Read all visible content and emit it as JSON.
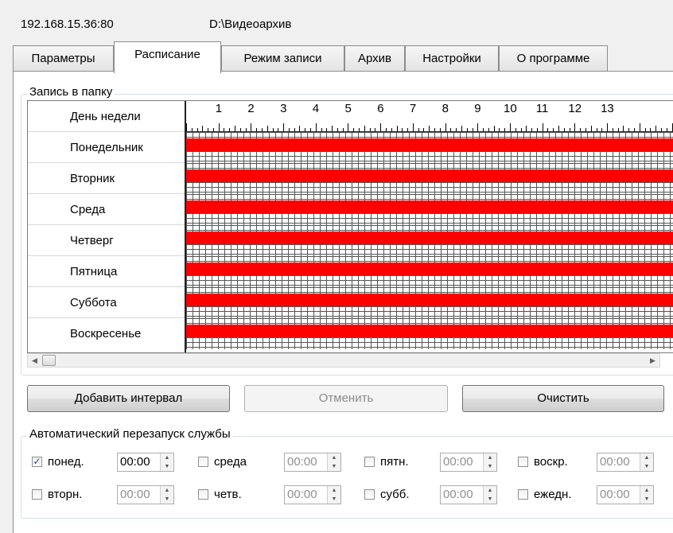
{
  "header": {
    "address": "192.168.15.36:80",
    "path": "D:\\Видеоархив"
  },
  "tabs": [
    {
      "label": "Параметры",
      "active": false
    },
    {
      "label": "Расписание",
      "active": true
    },
    {
      "label": "Режим записи",
      "active": false
    },
    {
      "label": "Архив",
      "active": false
    },
    {
      "label": "Настройки",
      "active": false
    },
    {
      "label": "О программе",
      "active": false
    }
  ],
  "schedule": {
    "group_title": "Запись в папку",
    "header_label": "День недели",
    "hours": [
      "1",
      "2",
      "3",
      "4",
      "5",
      "6",
      "7",
      "8",
      "9",
      "10",
      "11",
      "12",
      "13"
    ],
    "days": [
      "Понедельник",
      "Вторник",
      "Среда",
      "Четверг",
      "Пятница",
      "Суббота",
      "Воскресенье"
    ],
    "recording_color": "#ff0000"
  },
  "buttons": {
    "add_interval": "Добавить интервал",
    "cancel": "Отменить",
    "clear": "Очистить"
  },
  "restart": {
    "group_title": "Автоматический перезапуск службы",
    "items": [
      {
        "label": "понед.",
        "checked": true,
        "time": "00:00"
      },
      {
        "label": "среда",
        "checked": false,
        "time": "00:00"
      },
      {
        "label": "пятн.",
        "checked": false,
        "time": "00:00"
      },
      {
        "label": "воскр.",
        "checked": false,
        "time": "00:00"
      },
      {
        "label": "вторн.",
        "checked": false,
        "time": "00:00"
      },
      {
        "label": "четв.",
        "checked": false,
        "time": "00:00"
      },
      {
        "label": "субб.",
        "checked": false,
        "time": "00:00"
      },
      {
        "label": "ежедн.",
        "checked": false,
        "time": "00:00"
      }
    ],
    "check_mark": "✓"
  },
  "icons": {
    "scroll_left": "◀",
    "scroll_right": "▶",
    "spin_up": "▲",
    "spin_down": "▼"
  }
}
